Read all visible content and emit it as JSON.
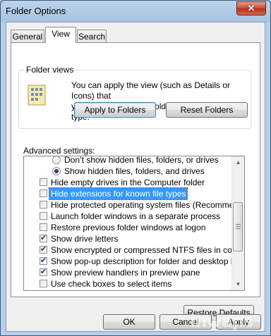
{
  "window": {
    "title": "Folder Options",
    "close_glyph": "✕"
  },
  "tabs": [
    {
      "label": "General"
    },
    {
      "label": "View"
    },
    {
      "label": "Search"
    }
  ],
  "folder_views": {
    "label": "Folder views",
    "description_line1": "You can apply the view (such as Details or Icons) that",
    "description_line2": "you are using for this folder to all folders of this type.",
    "apply_button": "Apply to Folders",
    "reset_button": "Reset Folders",
    "icon": "folder-options-icon"
  },
  "advanced": {
    "label": "Advanced settings:",
    "items": [
      {
        "type": "radio",
        "checked": false,
        "label": "Don’t show hidden files, folders, or drives"
      },
      {
        "type": "radio",
        "checked": true,
        "label": "Show hidden files, folders, and drives"
      },
      {
        "type": "checkbox",
        "checked": false,
        "label": "Hide empty drives in the Computer folder"
      },
      {
        "type": "checkbox",
        "checked": false,
        "label": "Hide extensions for known file types",
        "selected": true
      },
      {
        "type": "checkbox",
        "checked": false,
        "label": "Hide protected operating system files (Recommended)"
      },
      {
        "type": "checkbox",
        "checked": false,
        "label": "Launch folder windows in a separate process"
      },
      {
        "type": "checkbox",
        "checked": false,
        "label": "Restore previous folder windows at logon"
      },
      {
        "type": "checkbox",
        "checked": true,
        "label": "Show drive letters"
      },
      {
        "type": "checkbox",
        "checked": true,
        "label": "Show encrypted or compressed NTFS files in color"
      },
      {
        "type": "checkbox",
        "checked": true,
        "label": "Show pop-up description for folder and desktop items"
      },
      {
        "type": "checkbox",
        "checked": true,
        "label": "Show preview handlers in preview pane"
      },
      {
        "type": "checkbox",
        "checked": false,
        "label": "Use check boxes to select items"
      }
    ],
    "scroll_up": "▲",
    "scroll_down": "▼"
  },
  "restore_defaults_button": "Restore Defaults",
  "footer": {
    "ok": "OK",
    "cancel": "Cancel",
    "apply": "Apply"
  },
  "watermark": "inwaps"
}
